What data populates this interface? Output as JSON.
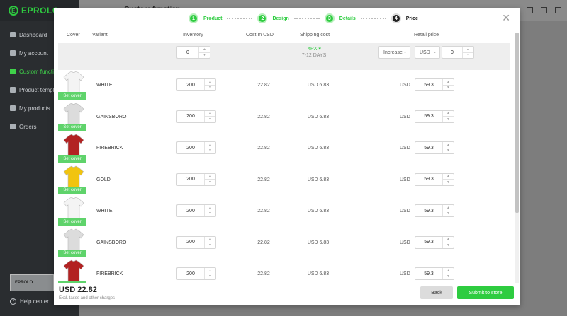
{
  "app": {
    "logo_text": "EPROLO",
    "bg_title": "Custom function",
    "brand_badge": "EPROLO"
  },
  "sidebar": {
    "items": [
      {
        "label": "Dashboard",
        "icon": "dashboard-icon",
        "active": false
      },
      {
        "label": "My account",
        "icon": "account-icon",
        "active": false
      },
      {
        "label": "Custom functi",
        "icon": "custom-function-icon",
        "active": true
      },
      {
        "label": "Product templ",
        "icon": "product-template-icon",
        "active": false
      },
      {
        "label": "My products",
        "icon": "products-icon",
        "active": false
      },
      {
        "label": "Orders",
        "icon": "orders-icon",
        "active": false
      }
    ],
    "help_label": "Help center"
  },
  "steps": [
    {
      "num": "1",
      "label": "Product"
    },
    {
      "num": "2",
      "label": "Design"
    },
    {
      "num": "3",
      "label": "Details"
    },
    {
      "num": "4",
      "label": "Price"
    }
  ],
  "columns": {
    "cover": "Cover",
    "variant": "Variant",
    "inventory": "Inventory",
    "cost": "Cost In USD",
    "shipping": "Shipping cost",
    "retail": "Retail price"
  },
  "filter": {
    "inventory_value": "0",
    "shipping_method": "4PX ▾",
    "shipping_days": "7-12 DAYS",
    "adjust_mode": "Increase",
    "currency": "USD",
    "adjust_value": "0"
  },
  "rows": [
    {
      "color": "WHITE",
      "shirt_color": "#f4f4f4",
      "inventory": "200",
      "cost": "22.82",
      "shipping": "USD 6.83",
      "currency": "USD",
      "price": "59.3",
      "cover_label": "Set cover"
    },
    {
      "color": "GAINSBORO",
      "shirt_color": "#dcdcdc",
      "inventory": "200",
      "cost": "22.82",
      "shipping": "USD 6.83",
      "currency": "USD",
      "price": "59.3",
      "cover_label": "Set cover"
    },
    {
      "color": "FIREBRICK",
      "shirt_color": "#b22222",
      "inventory": "200",
      "cost": "22.82",
      "shipping": "USD 6.83",
      "currency": "USD",
      "price": "59.3",
      "cover_label": "Set cover"
    },
    {
      "color": "GOLD",
      "shirt_color": "#f1c40f",
      "inventory": "200",
      "cost": "22.82",
      "shipping": "USD 6.83",
      "currency": "USD",
      "price": "59.3",
      "cover_label": "Set cover"
    },
    {
      "color": "WHITE",
      "shirt_color": "#f4f4f4",
      "inventory": "200",
      "cost": "22.82",
      "shipping": "USD 6.83",
      "currency": "USD",
      "price": "59.3",
      "cover_label": "Set cover"
    },
    {
      "color": "GAINSBORO",
      "shirt_color": "#dcdcdc",
      "inventory": "200",
      "cost": "22.82",
      "shipping": "USD 6.83",
      "currency": "USD",
      "price": "59.3",
      "cover_label": "Set cover"
    },
    {
      "color": "FIREBRICK",
      "shirt_color": "#b22222",
      "inventory": "200",
      "cost": "22.82",
      "shipping": "USD 6.83",
      "currency": "USD",
      "price": "59.3",
      "cover_label": "Set cover"
    }
  ],
  "footer": {
    "total": "USD 22.82",
    "note": "Excl. taxes and other charges",
    "back_label": "Back",
    "submit_label": "Submit to store"
  },
  "colors": {
    "accent": "#2ecc40",
    "sidebar_bg": "#2a2d30"
  }
}
